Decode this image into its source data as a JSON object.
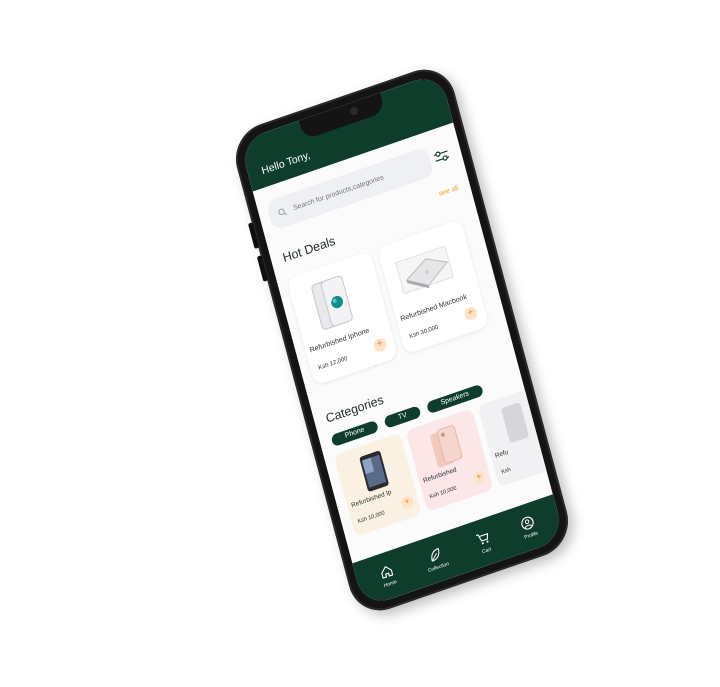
{
  "header": {
    "greeting": "Hello Tony,"
  },
  "search": {
    "placeholder": "Search for products,categories"
  },
  "hot_deals": {
    "title": "Hot Deals",
    "see_all": "see all",
    "items": [
      {
        "name": "Refurbished Iphone",
        "price": "Ksh 12,000",
        "icon": "iphone-image"
      },
      {
        "name": "Refurbished Macbook",
        "price": "Ksh 30,000",
        "icon": "macbook-image"
      }
    ]
  },
  "categories": {
    "title": "Categories",
    "chips": [
      "Phone",
      "TV",
      "Speakers"
    ],
    "items": [
      {
        "name": "Refurbished Ip",
        "price": "Ksh 10,000",
        "bg": "#fbf1e2"
      },
      {
        "name": "Refurbished",
        "price": "Ksh 10,000",
        "bg": "#fbe7e7"
      },
      {
        "name": "Refu",
        "price": "Ksh",
        "bg": "#f1f1f3"
      }
    ]
  },
  "nav": {
    "items": [
      {
        "label": "Home",
        "icon": "home-icon"
      },
      {
        "label": "Collection",
        "icon": "leaf-icon"
      },
      {
        "label": "Cart",
        "icon": "cart-icon"
      },
      {
        "label": "Profile",
        "icon": "profile-icon"
      }
    ]
  },
  "colors": {
    "brand": "#0f3d2c",
    "accent": "#f0a020",
    "plus_bg": "#fde4c8"
  }
}
